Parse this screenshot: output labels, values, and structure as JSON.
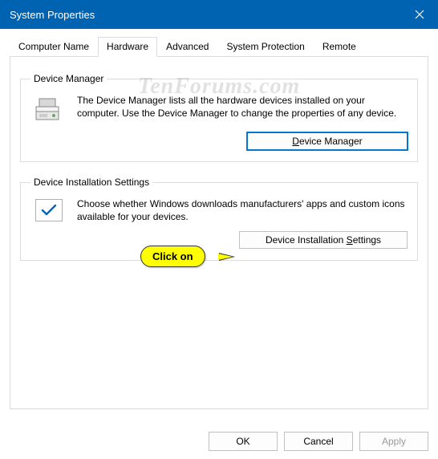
{
  "window": {
    "title": "System Properties"
  },
  "tabs": {
    "computer_name": "Computer Name",
    "hardware": "Hardware",
    "advanced": "Advanced",
    "system_protection": "System Protection",
    "remote": "Remote"
  },
  "device_manager": {
    "legend": "Device Manager",
    "description": "The Device Manager lists all the hardware devices installed on your computer. Use the Device Manager to change the properties of any device.",
    "button_prefix": "",
    "button_accel": "D",
    "button_suffix": "evice Manager"
  },
  "device_install": {
    "legend": "Device Installation Settings",
    "description": "Choose whether Windows downloads manufacturers' apps and custom icons available for your devices.",
    "button_prefix": "Device Installation ",
    "button_accel": "S",
    "button_suffix": "ettings"
  },
  "callout": {
    "text": "Click on"
  },
  "watermark": {
    "text": "TenForums.com"
  },
  "footer": {
    "ok": "OK",
    "cancel": "Cancel",
    "apply": "Apply"
  }
}
